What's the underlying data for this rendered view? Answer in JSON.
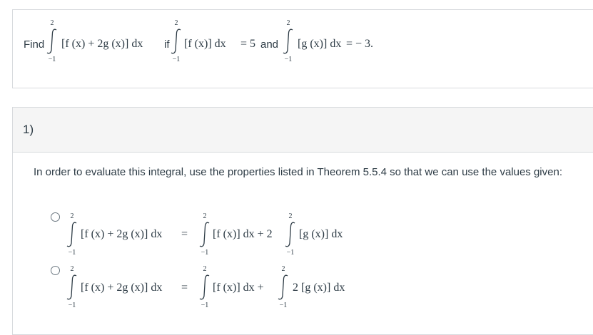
{
  "question": {
    "find_label": "Find",
    "expr_integrand": "[f (x) + 2g (x)] dx",
    "if_label": "if",
    "given1_integrand": "[f (x)] dx",
    "equals_5": "= 5",
    "and_label": "and",
    "given2_integrand": "[g (x)] dx",
    "equals_neg3": "= − 3.",
    "upper_limit": "2",
    "lower_limit": "−1"
  },
  "part": {
    "number": "1)",
    "instruction": "In order to evaluate this integral, use the properties listed in Theorem 5.5.4 so that we can use the values given:"
  },
  "options": [
    {
      "lhs": "[f (x) + 2g (x)] dx",
      "eq": "=",
      "rhs_a": "[f (x)] dx + 2",
      "rhs_b": "[g (x)] dx"
    },
    {
      "lhs": "[f (x) + 2g (x)] dx",
      "eq": "=",
      "rhs_a": "[f (x)] dx +",
      "rhs_b": "2 [g (x)] dx"
    }
  ]
}
